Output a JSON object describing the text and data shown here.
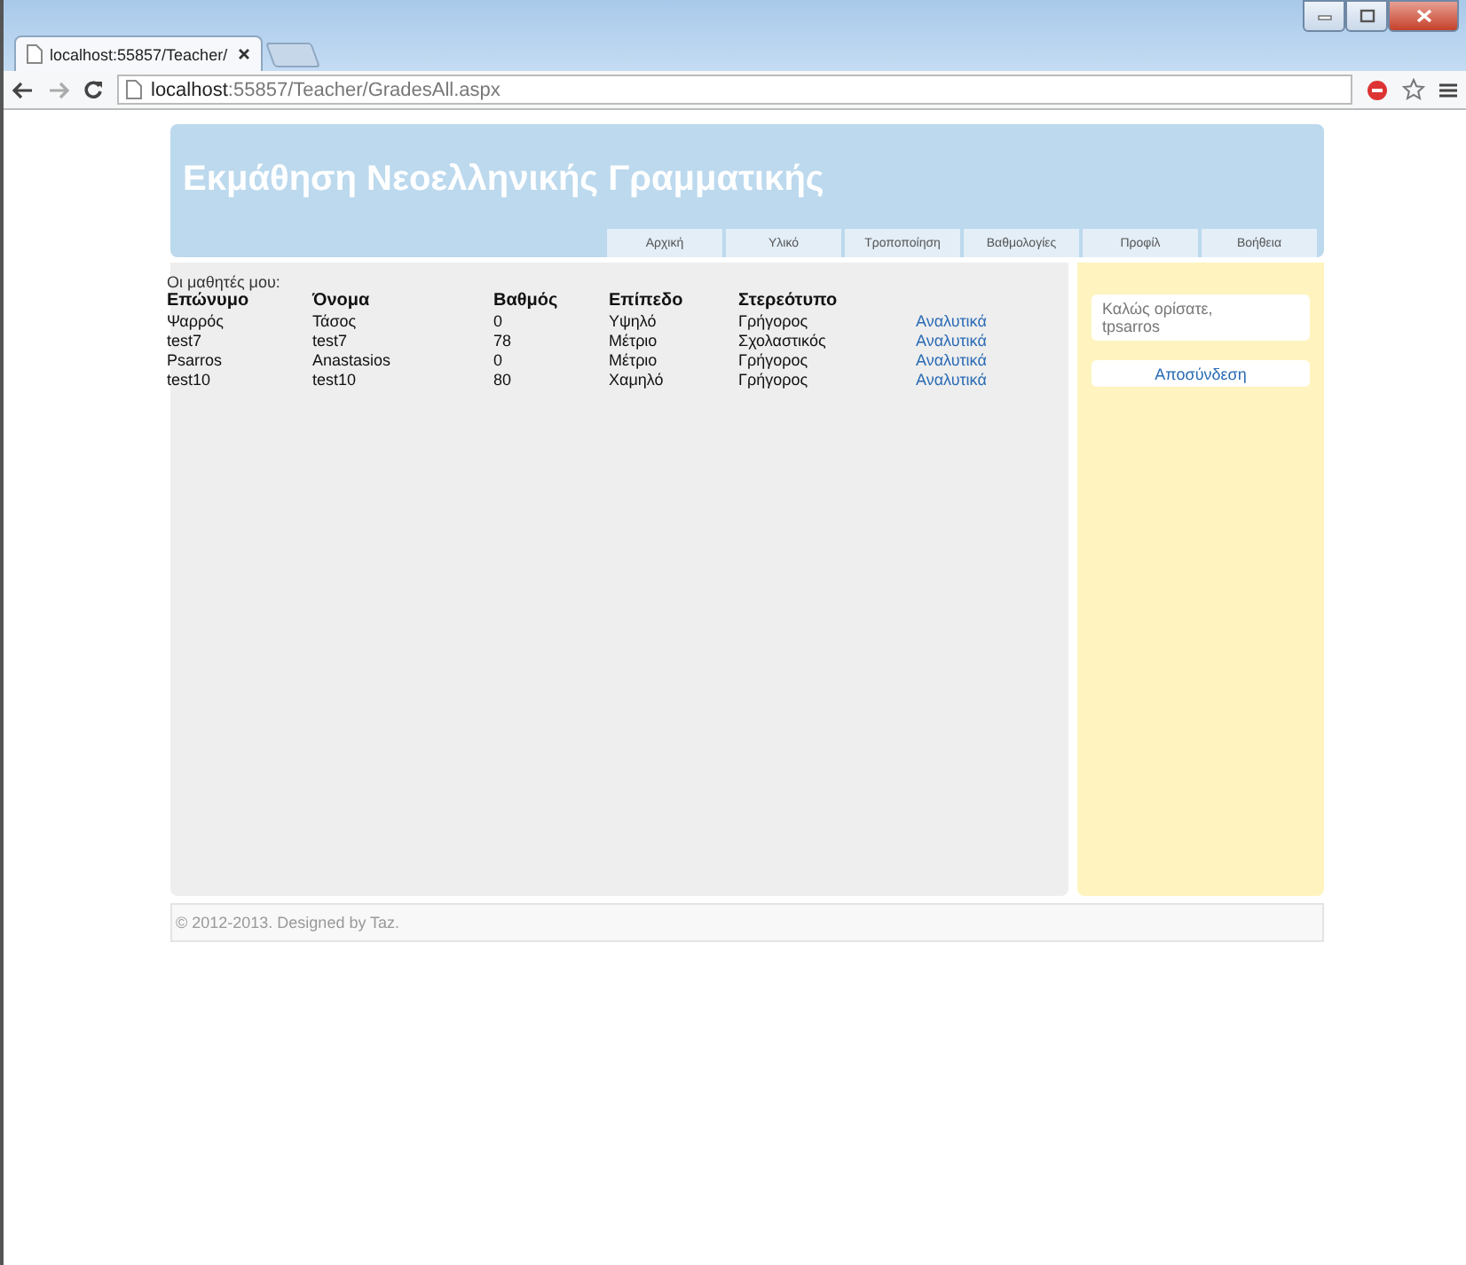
{
  "browser": {
    "tab_title": "localhost:55857/Teacher/",
    "url_host": "localhost",
    "url_path": ":55857/Teacher/GradesAll.aspx"
  },
  "site": {
    "title": "Εκμάθηση Νεοελληνικής Γραμματικής",
    "nav": [
      {
        "label": "Αρχική"
      },
      {
        "label": "Υλικό"
      },
      {
        "label": "Τροποποίηση"
      },
      {
        "label": "Βαθμολογίες"
      },
      {
        "label": "Προφίλ"
      },
      {
        "label": "Βοήθεια"
      }
    ]
  },
  "table": {
    "caption": "Οι μαθητές μου:",
    "columns": [
      "Επώνυμο",
      "Όνομα",
      "Βαθμός",
      "Επίπεδο",
      "Στερεότυπο"
    ],
    "rows": [
      {
        "cells": [
          "Ψαρρός",
          "Τάσος",
          "0",
          "Υψηλό",
          "Γρήγορος"
        ],
        "link": "Αναλυτικά"
      },
      {
        "cells": [
          "test7",
          "test7",
          "78",
          "Μέτριο",
          "Σχολαστικός"
        ],
        "link": "Αναλυτικά"
      },
      {
        "cells": [
          "Psarros",
          "Anastasios",
          "0",
          "Μέτριο",
          "Γρήγορος"
        ],
        "link": "Αναλυτικά"
      },
      {
        "cells": [
          "test10",
          "test10",
          "80",
          "Χαμηλό",
          "Γρήγορος"
        ],
        "link": "Αναλυτικά"
      }
    ]
  },
  "sidebar": {
    "welcome": "Καλώς ορίσατε,",
    "username": "tpsarros",
    "logout": "Αποσύνδεση"
  },
  "footer": "© 2012-2013. Designed by Taz."
}
